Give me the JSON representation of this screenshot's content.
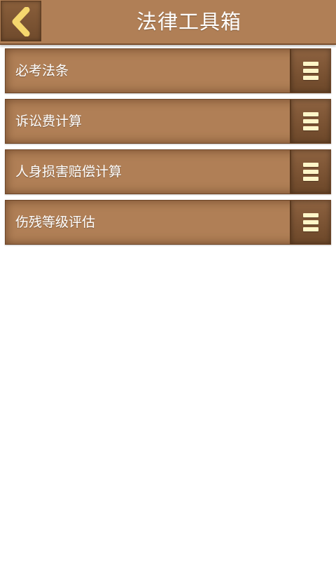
{
  "header": {
    "title": "法律工具箱",
    "back_icon": "chevron-left-icon"
  },
  "items": [
    {
      "label": "必考法条",
      "icon": "menu-icon"
    },
    {
      "label": "诉讼费计算",
      "icon": "menu-icon"
    },
    {
      "label": "人身损害赔偿计算",
      "icon": "menu-icon"
    },
    {
      "label": "伤残等级评估",
      "icon": "menu-icon"
    }
  ],
  "colors": {
    "header_bg": "#b07f56",
    "item_bg": "#b07f56",
    "button_bg": "#7a5233",
    "icon_fill": "#fff6c8",
    "chevron": "#f5d76e",
    "page_bg": "#ffffff"
  }
}
